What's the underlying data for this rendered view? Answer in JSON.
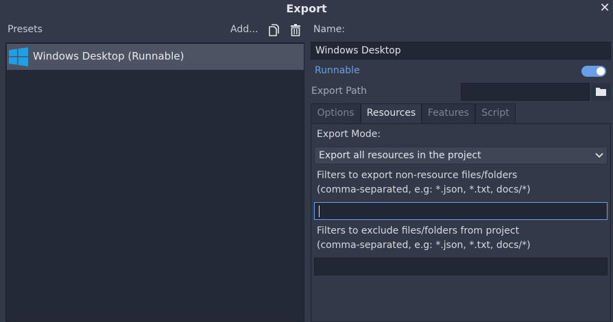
{
  "window": {
    "title": "Export"
  },
  "presets": {
    "header": "Presets",
    "add_label": "Add...",
    "items": [
      {
        "label": "Windows Desktop (Runnable)",
        "icon": "windows-logo-icon",
        "selected": true
      }
    ]
  },
  "details": {
    "name_label": "Name:",
    "name_value": "Windows Desktop",
    "runnable_label": "Runnable",
    "runnable_on": true,
    "export_path_label": "Export Path",
    "export_path_value": ""
  },
  "tabs": [
    {
      "label": "Options",
      "active": false
    },
    {
      "label": "Resources",
      "active": true
    },
    {
      "label": "Features",
      "active": false
    },
    {
      "label": "Script",
      "active": false
    }
  ],
  "resources": {
    "export_mode_label": "Export Mode:",
    "export_mode_value": "Export all resources in the project",
    "include_filter_label_1": "Filters to export non-resource files/folders",
    "include_filter_label_2": "(comma-separated, e.g: *.json, *.txt, docs/*)",
    "include_filter_value": "",
    "exclude_filter_label_1": "Filters to exclude files/folders from project",
    "exclude_filter_label_2": "(comma-separated, e.g: *.json, *.txt, docs/*)",
    "exclude_filter_value": ""
  },
  "colors": {
    "background": "#323a4a",
    "accent": "#6d9ee8",
    "selected_item": "#4c5362",
    "windows_logo": "#1fa0e6"
  }
}
